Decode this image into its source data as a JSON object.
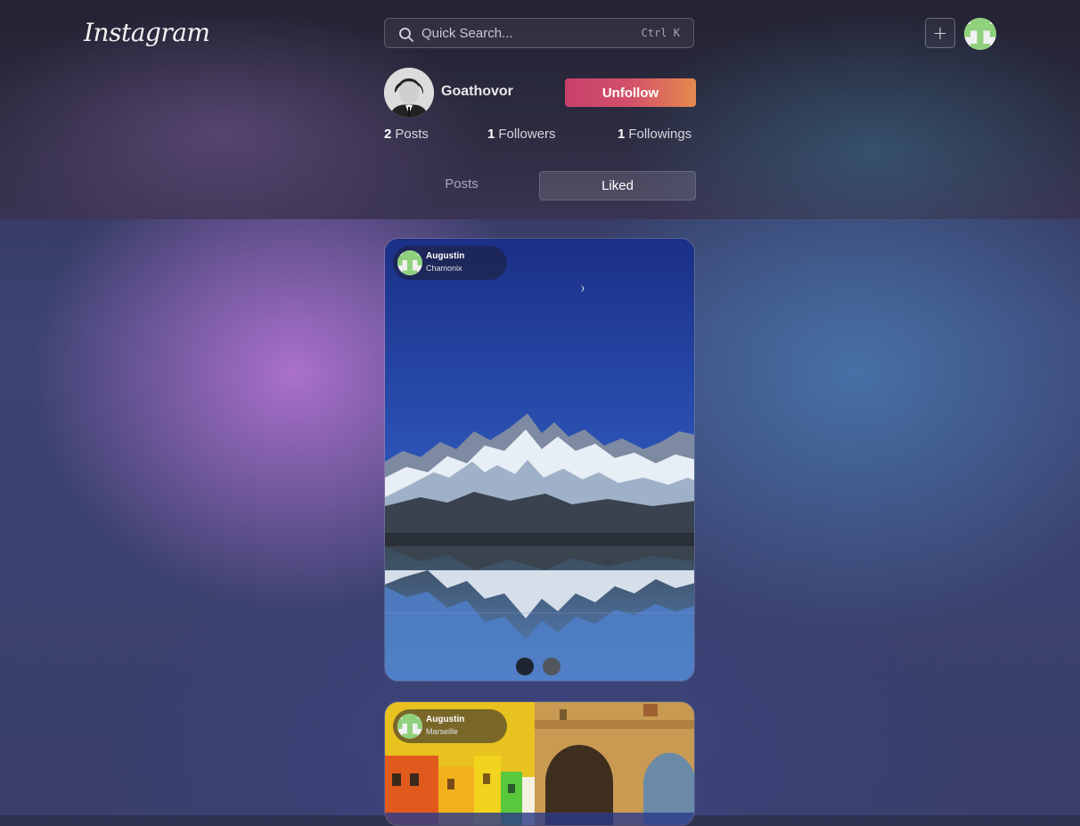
{
  "brand": {
    "logo_text": "Instagram"
  },
  "search": {
    "placeholder": "Quick Search...",
    "shortcut": "Ctrl K"
  },
  "header": {
    "add_icon": "plus-icon",
    "avatar_icon": "identicon-avatar"
  },
  "profile": {
    "username": "Goathovor",
    "action_label": "Unfollow",
    "stats": [
      {
        "count": "2",
        "label": "Posts"
      },
      {
        "count": "1",
        "label": "Followers"
      },
      {
        "count": "1",
        "label": "Followings"
      }
    ]
  },
  "tabs": [
    {
      "label": "Posts",
      "active": false
    },
    {
      "label": "Liked",
      "active": true
    }
  ],
  "posts": [
    {
      "author": "Augustin",
      "location": "Chamonix",
      "slides": 2,
      "current_slide": 1
    },
    {
      "author": "Augustin",
      "location": "Marseille"
    }
  ],
  "colors": {
    "accent_start": "#c7406c",
    "accent_end": "#e58a4e",
    "identicon_green": "#8fd17c"
  }
}
